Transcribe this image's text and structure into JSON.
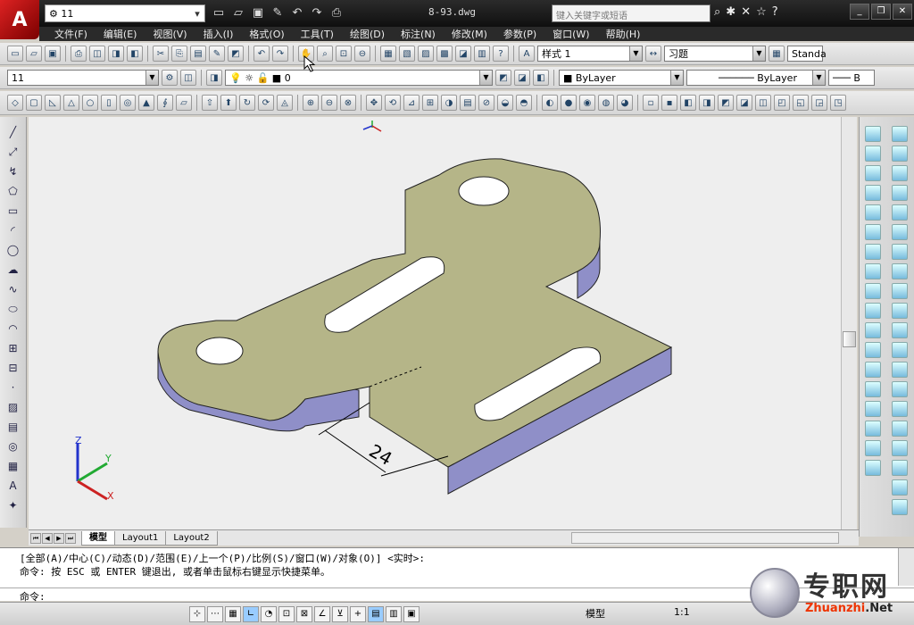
{
  "app": {
    "logo_letter": "A",
    "workspace_value": "11",
    "title": "8-93.dwg",
    "search_placeholder": "键入关键字或短语"
  },
  "menu": [
    "文件(F)",
    "编辑(E)",
    "视图(V)",
    "插入(I)",
    "格式(O)",
    "工具(T)",
    "绘图(D)",
    "标注(N)",
    "修改(M)",
    "参数(P)",
    "窗口(W)",
    "帮助(H)"
  ],
  "styles": {
    "text_style": "样式 1",
    "dim_style": "习题",
    "table_style": "Standa"
  },
  "layer": {
    "layer_select": "11",
    "current_layer": "0",
    "color": "ByLayer",
    "linetype": "ByLayer",
    "lineweight": "B"
  },
  "drawing": {
    "dimension_text": "24",
    "ucs_axes": [
      "Z",
      "Y",
      "X"
    ],
    "body_color": "#b5b588",
    "side_color": "#8f8fc8",
    "hole_color": "#ffffff"
  },
  "tabs": [
    "模型",
    "Layout1",
    "Layout2"
  ],
  "command": {
    "history_1": "[全部(A)/中心(C)/动态(D)/范围(E)/上一个(P)/比例(S)/窗口(W)/对象(O)] <实时>:",
    "history_2": "命令: 按 ESC 或 ENTER 键退出, 或者单击鼠标右键显示快捷菜单。",
    "prompt": "命令:"
  },
  "status": {
    "model_label": "模型",
    "scale_label": "1:1"
  },
  "watermark": {
    "text": "专职网",
    "url_a": "Zhuanzhi",
    "url_b": ".Net"
  }
}
